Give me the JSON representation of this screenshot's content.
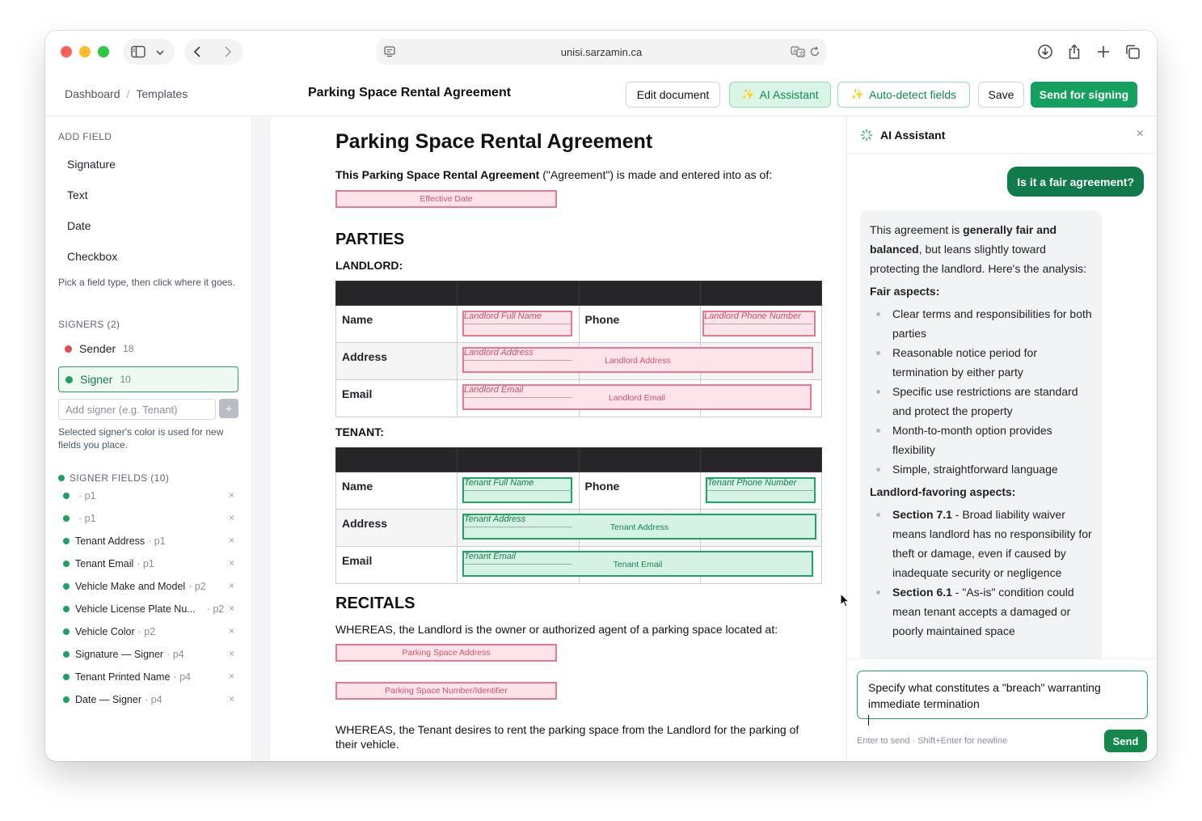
{
  "browser": {
    "url": "unisi.sarzamin.ca"
  },
  "header": {
    "breadcrumb": [
      "Dashboard",
      "Templates"
    ],
    "breadcrumb_sep": "/",
    "title": "Parking Space Rental Agreement",
    "buttons": {
      "edit": "Edit document",
      "ai": "AI Assistant",
      "auto": "Auto-detect fields",
      "save": "Save",
      "send": "Send for signing"
    },
    "sparkle_icon": "✨"
  },
  "sidebar": {
    "add_field_label": "ADD FIELD",
    "field_types": [
      "Signature",
      "Text",
      "Date",
      "Checkbox"
    ],
    "help_pick": "Pick a field type, then click where it goes.",
    "signers_label": "SIGNERS (2)",
    "signers": [
      {
        "name": "Sender",
        "count": "18",
        "color": "#e5484d"
      },
      {
        "name": "Signer",
        "count": "10",
        "color": "#1aa263"
      }
    ],
    "add_signer_placeholder": "Add signer (e.g. Tenant)",
    "add_signer_btn": "+",
    "help_color": "Selected signer's color is used for new fields you place.",
    "signer_fields_label": "SIGNER FIELDS (10)",
    "signer_fields": [
      {
        "name": "",
        "page": "· p1"
      },
      {
        "name": "",
        "page": "· p1"
      },
      {
        "name": "Tenant Address",
        "page": "· p1"
      },
      {
        "name": "Tenant Email",
        "page": "· p1"
      },
      {
        "name": "Vehicle Make and Model",
        "page": "· p2"
      },
      {
        "name": "Vehicle License Plate Nu...",
        "page": "· p2"
      },
      {
        "name": "Vehicle Color",
        "page": "· p2"
      },
      {
        "name": "Signature — Signer",
        "page": "· p4"
      },
      {
        "name": "Tenant Printed Name",
        "page": "· p4"
      },
      {
        "name": "Date — Signer",
        "page": "· p4"
      }
    ],
    "remove_glyph": "×"
  },
  "document": {
    "title": "Parking Space Rental Agreement",
    "intro_bold": "This Parking Space Rental Agreement",
    "intro_rest": " (\"Agreement\") is made and entered into as of:",
    "effective_date_field": "Effective Date",
    "parties_heading": "PARTIES",
    "landlord_label": "LANDLORD:",
    "tenant_label": "TENANT:",
    "row_labels": {
      "name": "Name",
      "phone": "Phone",
      "address": "Address",
      "email": "Email"
    },
    "landlord_fields": {
      "full_name": "Landlord Full Name",
      "phone": "Landlord Phone Number",
      "address": "Landlord Address",
      "email": "Landlord Email"
    },
    "tenant_fields": {
      "full_name": "Tenant Full Name",
      "phone": "Tenant Phone Number",
      "address": "Tenant Address",
      "email": "Tenant Email"
    },
    "recitals_heading": "RECITALS",
    "whereas_1": "WHEREAS, the Landlord is the owner or authorized agent of a parking space located at:",
    "parking_address_field": "Parking Space Address",
    "parking_number_field": "Parking Space Number/Identifier",
    "whereas_2": "WHEREAS, the Tenant desires to rent the parking space from the Landlord for the parking of their vehicle."
  },
  "ai_panel": {
    "title": "AI Assistant",
    "close": "×",
    "user_message": "Is it a fair agreement?",
    "reply": {
      "intro_a": "This agreement is ",
      "intro_bold": "generally fair and balanced",
      "intro_b": ", but leans slightly toward protecting the landlord. Here's the analysis:",
      "fair_heading": "Fair aspects:",
      "fair_items": [
        "Clear terms and responsibilities for both parties",
        "Reasonable notice period for termination by either party",
        "Specific use restrictions are standard and protect the property",
        "Month-to-month option provides flexibility",
        "Simple, straightforward language"
      ],
      "landlord_heading": "Landlord-favoring aspects:",
      "landlord_items": [
        {
          "bold": "Section 7.1",
          "text": " - Broad liability waiver means landlord has no responsibility for theft or damage, even if caused by inadequate security or negligence"
        },
        {
          "bold": "Section 6.1",
          "text": " - \"As-is\" condition could mean tenant accepts a damaged or poorly maintained space"
        }
      ]
    },
    "input_value": "Specify what constitutes a \"breach\" warranting immediate termination",
    "hint": "Enter to send · Shift+Enter for newline",
    "send": "Send"
  },
  "colors": {
    "sender_field_border": "#e8788f",
    "signer_field_border": "#1fa463",
    "primary": "#14a05d"
  }
}
